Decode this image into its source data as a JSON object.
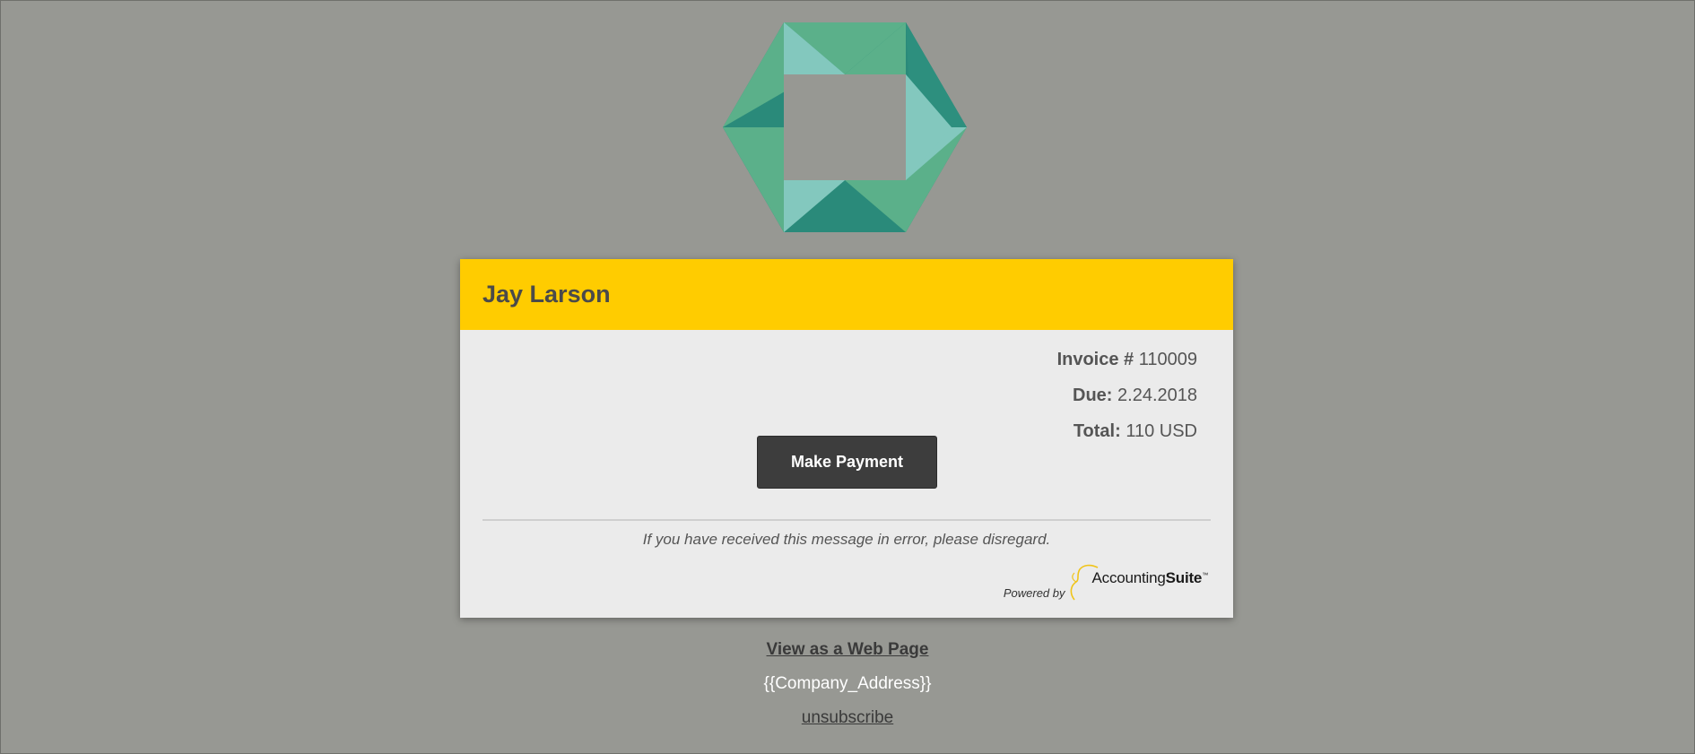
{
  "logo": {
    "icon": "hexagon-logo",
    "colors": [
      "#5bb08a",
      "#2a8a7a",
      "#83c8be"
    ]
  },
  "invoice": {
    "customer_name": "Jay Larson",
    "invoice_label": "Invoice #",
    "invoice_number": "110009",
    "due_label": "Due:",
    "due_date": "2.24.2018",
    "total_label": "Total:",
    "total_value": "110 USD",
    "pay_button_label": "Make Payment",
    "disclaimer": "If you have received this message in error, please disregard.",
    "powered_by_label": "Powered by",
    "brand_name_regular": "Accounting",
    "brand_name_bold": "Suite",
    "brand_tm": "™"
  },
  "footer": {
    "web_page_link": "View as a Web Page",
    "company_address": "{{Company_Address}}",
    "unsubscribe_link": "unsubscribe"
  },
  "colors": {
    "background": "#979893",
    "header_accent": "#ffcc00",
    "button": "#3d3d3d"
  }
}
